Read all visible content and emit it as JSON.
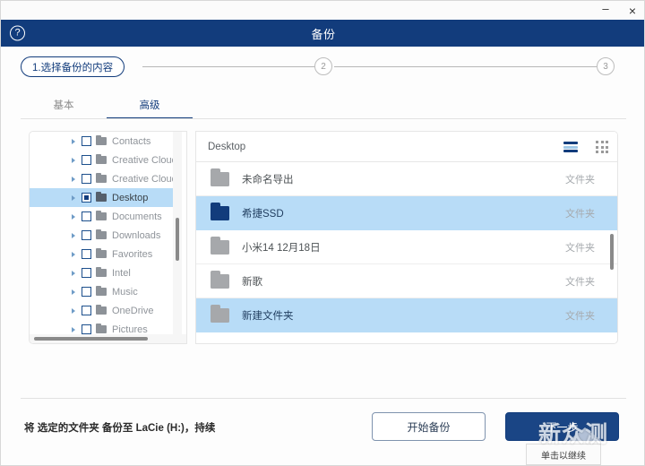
{
  "window": {
    "minimize_label": "–",
    "close_label": "×"
  },
  "header": {
    "title": "备份",
    "help_label": "?"
  },
  "stepper": {
    "step1_label": "1.选择备份的内容",
    "step2_label": "2",
    "step3_label": "3"
  },
  "tabs": [
    {
      "label": "基本",
      "active": false
    },
    {
      "label": "高级",
      "active": true
    }
  ],
  "tree": {
    "items": [
      {
        "label": "Contacts",
        "checked": false,
        "selected": false
      },
      {
        "label": "Creative Cloud File",
        "checked": false,
        "selected": false
      },
      {
        "label": "Creative Cloud File",
        "checked": false,
        "selected": false
      },
      {
        "label": "Desktop",
        "checked": true,
        "selected": true
      },
      {
        "label": "Documents",
        "checked": false,
        "selected": false
      },
      {
        "label": "Downloads",
        "checked": false,
        "selected": false
      },
      {
        "label": "Favorites",
        "checked": false,
        "selected": false
      },
      {
        "label": "Intel",
        "checked": false,
        "selected": false
      },
      {
        "label": "Music",
        "checked": false,
        "selected": false
      },
      {
        "label": "OneDrive",
        "checked": false,
        "selected": false
      },
      {
        "label": "Pictures",
        "checked": false,
        "selected": false
      }
    ]
  },
  "list": {
    "path_label": "Desktop",
    "view_list_icon": "list-view-icon",
    "view_grid_icon": "grid-view-icon",
    "rows": [
      {
        "name": "未命名导出",
        "type": "文件夹",
        "selected": false,
        "folder_color": "gray"
      },
      {
        "name": "希捷SSD",
        "type": "文件夹",
        "selected": true,
        "folder_color": "blue"
      },
      {
        "name": "小米14 12月18日",
        "type": "文件夹",
        "selected": false,
        "folder_color": "gray"
      },
      {
        "name": "新歌",
        "type": "文件夹",
        "selected": false,
        "folder_color": "gray"
      },
      {
        "name": "新建文件夹",
        "type": "文件夹",
        "selected": true,
        "folder_color": "gray"
      }
    ]
  },
  "footer": {
    "status_text": "将 选定的文件夹 备份至 LaCie (H:)，持续",
    "start_backup_label": "开始备份",
    "next_label": "下一步",
    "tooltip_text": "单击以继续"
  },
  "watermark": {
    "text": "新众测"
  },
  "colors": {
    "brand_navy": "#123c7c",
    "selection_blue": "#b8dcf7",
    "primary_button": "#1a4585"
  }
}
